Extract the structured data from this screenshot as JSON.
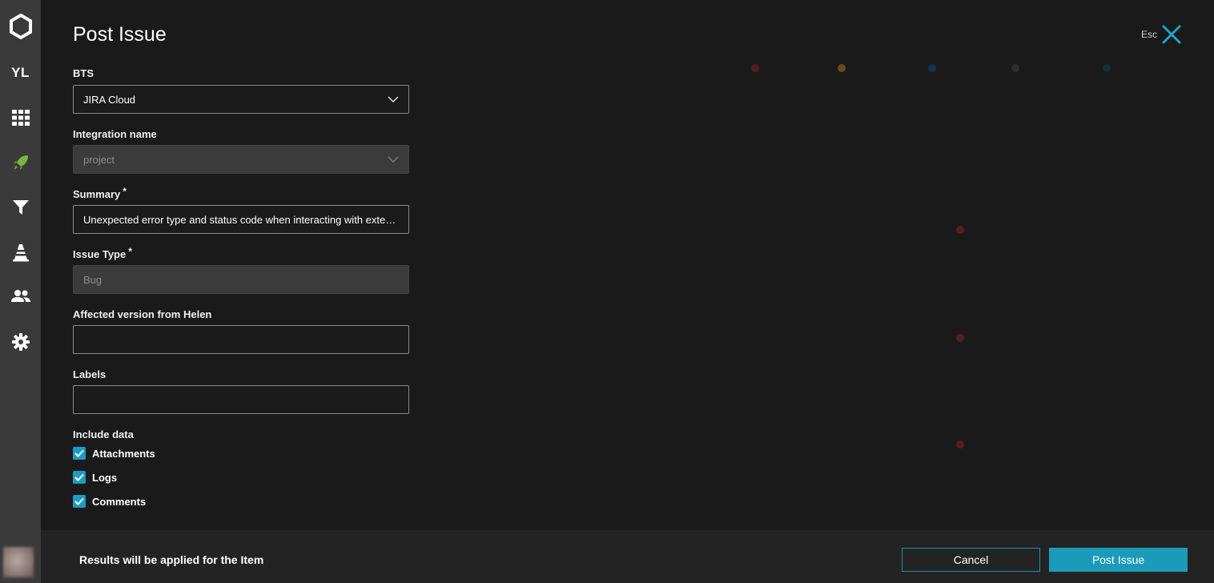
{
  "nav": {
    "logo_icon": "reportportal-logo-icon",
    "project_badge": "YL",
    "items": [
      {
        "icon": "dashboard-grid-icon"
      },
      {
        "icon": "launches-rocket-icon",
        "active": true,
        "active_color": "#7cb342"
      },
      {
        "icon": "filters-funnel-icon"
      },
      {
        "icon": "debug-cone-icon"
      },
      {
        "icon": "members-icon"
      },
      {
        "icon": "settings-gear-icon"
      }
    ]
  },
  "modal": {
    "title": "Post Issue",
    "esc_label": "Esc",
    "close_icon": "close-icon",
    "accent_color": "#1c9ab9",
    "fields": {
      "bts": {
        "label": "BTS",
        "value": "JIRA Cloud"
      },
      "integration": {
        "label": "Integration name",
        "value": "project"
      },
      "summary": {
        "label": "Summary",
        "required_mark": "*",
        "value": "Unexpected error type and status code when interacting with external service"
      },
      "issue_type": {
        "label": "Issue Type",
        "required_mark": "*",
        "value": "Bug"
      },
      "affected_version": {
        "label": "Affected version from Helen",
        "value": ""
      },
      "labels": {
        "label": "Labels",
        "value": ""
      }
    },
    "include_data": {
      "label": "Include data",
      "options": [
        {
          "label": "Attachments",
          "checked": true
        },
        {
          "label": "Logs",
          "checked": true
        },
        {
          "label": "Comments",
          "checked": true
        }
      ]
    }
  },
  "footer": {
    "info": "Results will be applied for the Item",
    "cancel_label": "Cancel",
    "post_label": "Post Issue"
  }
}
